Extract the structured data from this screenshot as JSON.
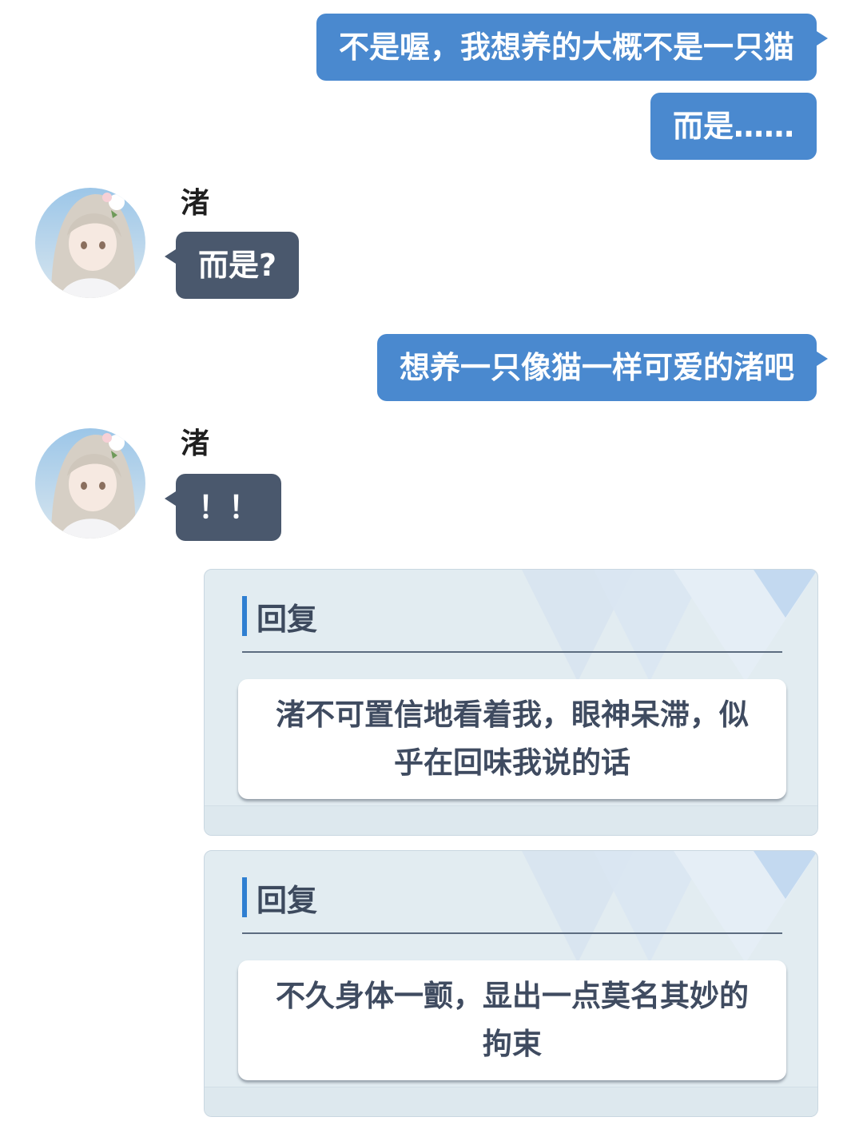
{
  "messages": {
    "out_1": "不是喔，我想养的大概不是一只猫",
    "out_2": "而是……",
    "in_1": {
      "sender": "渚",
      "text": "而是?"
    },
    "out_3": "想养一只像猫一样可爱的渚吧",
    "in_2": {
      "sender": "渚",
      "text": "！！"
    }
  },
  "replies": [
    {
      "header": "回复",
      "option": "渚不可置信地看着我，眼神呆滞，似乎在回味我说的话"
    },
    {
      "header": "回复",
      "option": "不久身体一颤，显出一点莫名其妙的拘束"
    }
  ],
  "colors": {
    "outgoing_bubble": "#4a89cf",
    "incoming_bubble": "#4a586d",
    "reply_accent": "#2f7fd1"
  },
  "icons": {
    "avatar": "nagisa-avatar-image"
  }
}
